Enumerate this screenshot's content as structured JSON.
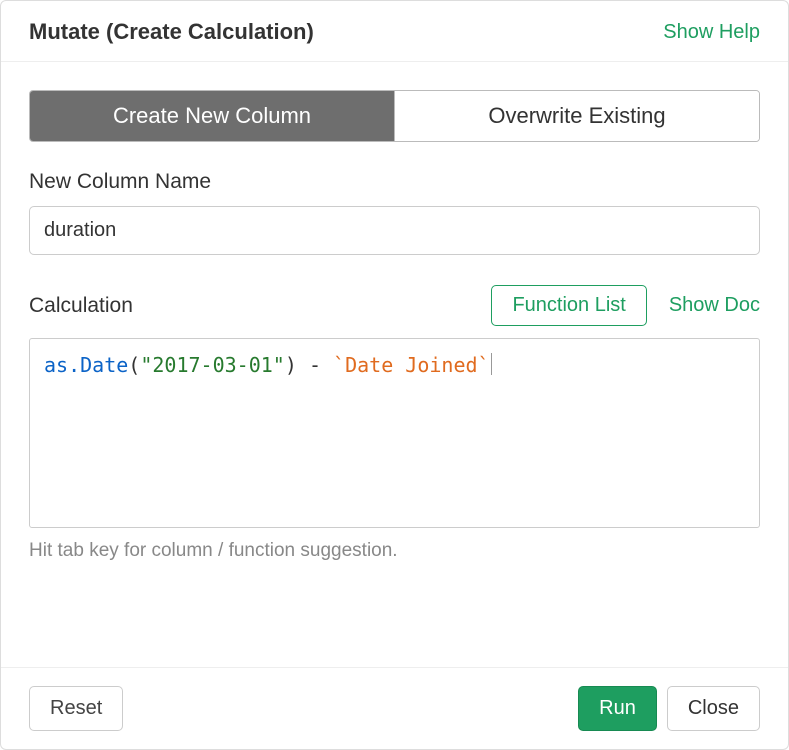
{
  "header": {
    "title": "Mutate (Create Calculation)",
    "show_help": "Show Help"
  },
  "tabs": {
    "create": "Create New Column",
    "overwrite": "Overwrite Existing"
  },
  "column_name": {
    "label": "New Column Name",
    "value": "duration"
  },
  "calculation": {
    "label": "Calculation",
    "function_list": "Function List",
    "show_doc": "Show Doc",
    "code_tokens": {
      "func": "as.Date",
      "paren_open": "(",
      "string": "\"2017-03-01\"",
      "paren_close": ")",
      "space1": " ",
      "minus": "-",
      "space2": " ",
      "column": "`Date Joined`"
    },
    "hint": "Hit tab key for column / function suggestion."
  },
  "footer": {
    "reset": "Reset",
    "run": "Run",
    "close": "Close"
  }
}
